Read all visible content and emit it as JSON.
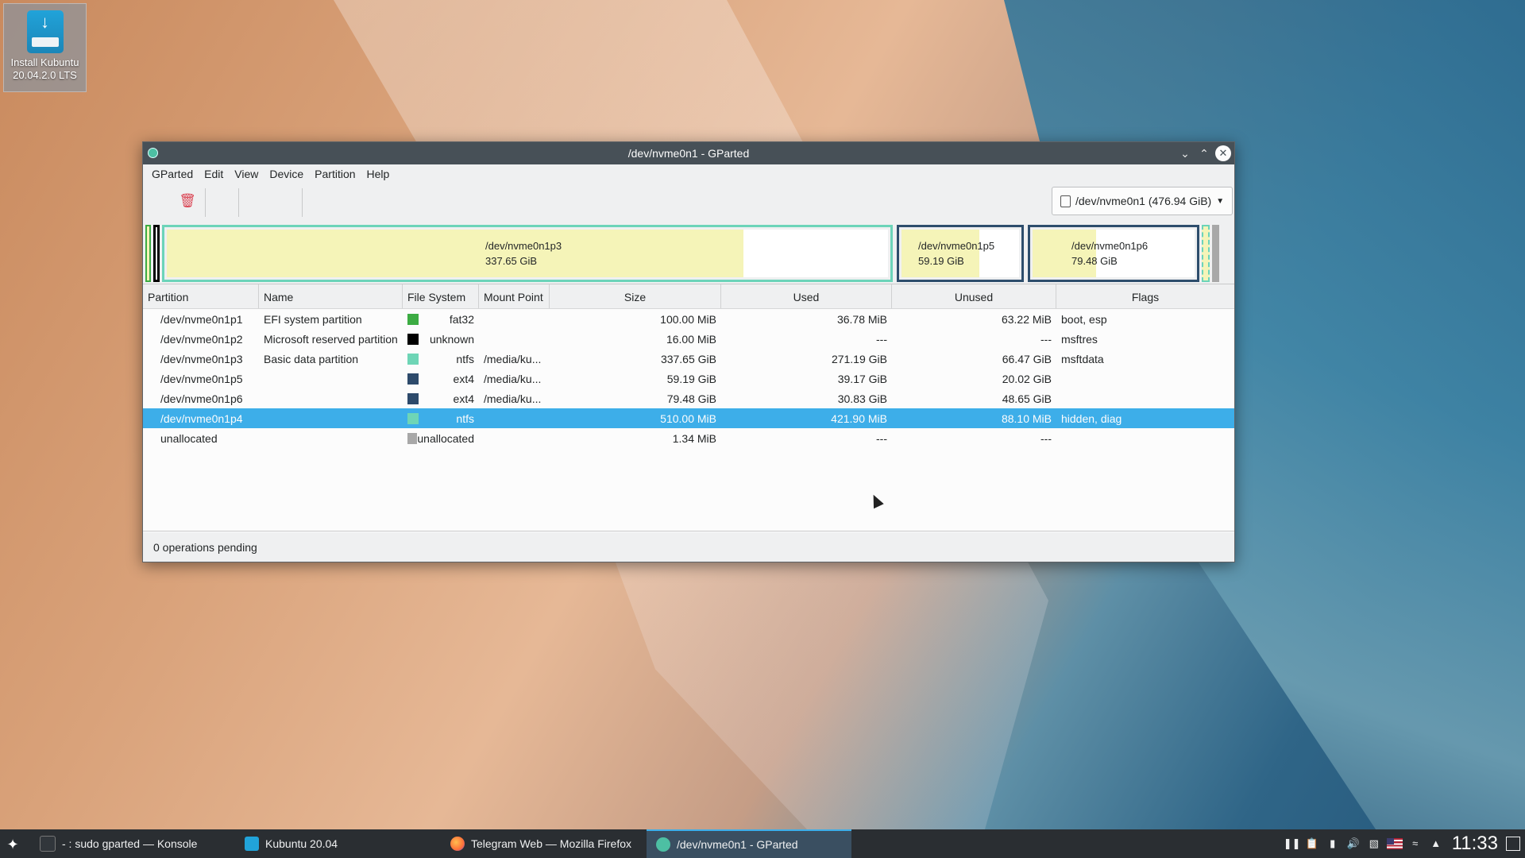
{
  "desktop": {
    "icon_label_line1": "Install Kubuntu",
    "icon_label_line2": "20.04.2.0 LTS"
  },
  "window": {
    "title": "/dev/nvme0n1 - GParted",
    "menu": [
      "GParted",
      "Edit",
      "View",
      "Device",
      "Partition",
      "Help"
    ],
    "device_selector": "/dev/nvme0n1 (476.94 GiB)"
  },
  "partition_map": {
    "p3": {
      "name": "/dev/nvme0n1p3",
      "size": "337.65 GiB",
      "used_fraction": 0.8,
      "border": "#6cd4b9"
    },
    "p5": {
      "name": "/dev/nvme0n1p5",
      "size": "59.19 GiB",
      "used_fraction": 0.66,
      "border": "#2d4d6c"
    },
    "p6": {
      "name": "/dev/nvme0n1p6",
      "size": "79.48 GiB",
      "used_fraction": 0.39,
      "border": "#2d4d6c"
    }
  },
  "table": {
    "headers": [
      "Partition",
      "Name",
      "File System",
      "Mount Point",
      "Size",
      "Used",
      "Unused",
      "Flags"
    ],
    "rows": [
      {
        "partition": "/dev/nvme0n1p1",
        "name": "EFI system partition",
        "fs": "fat32",
        "fs_color": "#3cac43",
        "mount": "",
        "size": "100.00 MiB",
        "used": "36.78 MiB",
        "unused": "63.22 MiB",
        "flags": "boot, esp"
      },
      {
        "partition": "/dev/nvme0n1p2",
        "name": "Microsoft reserved partition",
        "fs": "unknown",
        "fs_color": "#000000",
        "mount": "",
        "size": "16.00 MiB",
        "used": "---",
        "unused": "---",
        "flags": "msftres"
      },
      {
        "partition": "/dev/nvme0n1p3",
        "name": "Basic data partition",
        "fs": "ntfs",
        "fs_color": "#6ed5b6",
        "mount": "/media/ku...",
        "size": "337.65 GiB",
        "used": "271.19 GiB",
        "unused": "66.47 GiB",
        "flags": "msftdata"
      },
      {
        "partition": "/dev/nvme0n1p5",
        "name": "",
        "fs": "ext4",
        "fs_color": "#2d4a6b",
        "mount": "/media/ku...",
        "size": "59.19 GiB",
        "used": "39.17 GiB",
        "unused": "20.02 GiB",
        "flags": ""
      },
      {
        "partition": "/dev/nvme0n1p6",
        "name": "",
        "fs": "ext4",
        "fs_color": "#2d4a6b",
        "mount": "/media/ku...",
        "size": "79.48 GiB",
        "used": "30.83 GiB",
        "unused": "48.65 GiB",
        "flags": ""
      },
      {
        "partition": "/dev/nvme0n1p4",
        "name": "",
        "fs": "ntfs",
        "fs_color": "#6ed5b6",
        "mount": "",
        "size": "510.00 MiB",
        "used": "421.90 MiB",
        "unused": "88.10 MiB",
        "flags": "hidden, diag"
      },
      {
        "partition": "unallocated",
        "name": "",
        "fs": "unallocated",
        "fs_color": "#a8a8a8",
        "mount": "",
        "size": "1.34 MiB",
        "used": "---",
        "unused": "---",
        "flags": ""
      }
    ],
    "selected_row": 5
  },
  "status": "0 operations pending",
  "taskbar": {
    "tasks": [
      {
        "label": "- : sudo gparted — Konsole",
        "icon": "terminal-icon"
      },
      {
        "label": "Kubuntu 20.04",
        "icon": "installer-icon"
      },
      {
        "label": "Telegram Web — Mozilla Firefox",
        "icon": "firefox-icon"
      },
      {
        "label": "/dev/nvme0n1 - GParted",
        "icon": "gparted-icon"
      }
    ],
    "clock": "11:33"
  },
  "colors": {
    "accent": "#3daee9",
    "titlebar": "#475057",
    "taskbar": "#2a2e32"
  }
}
